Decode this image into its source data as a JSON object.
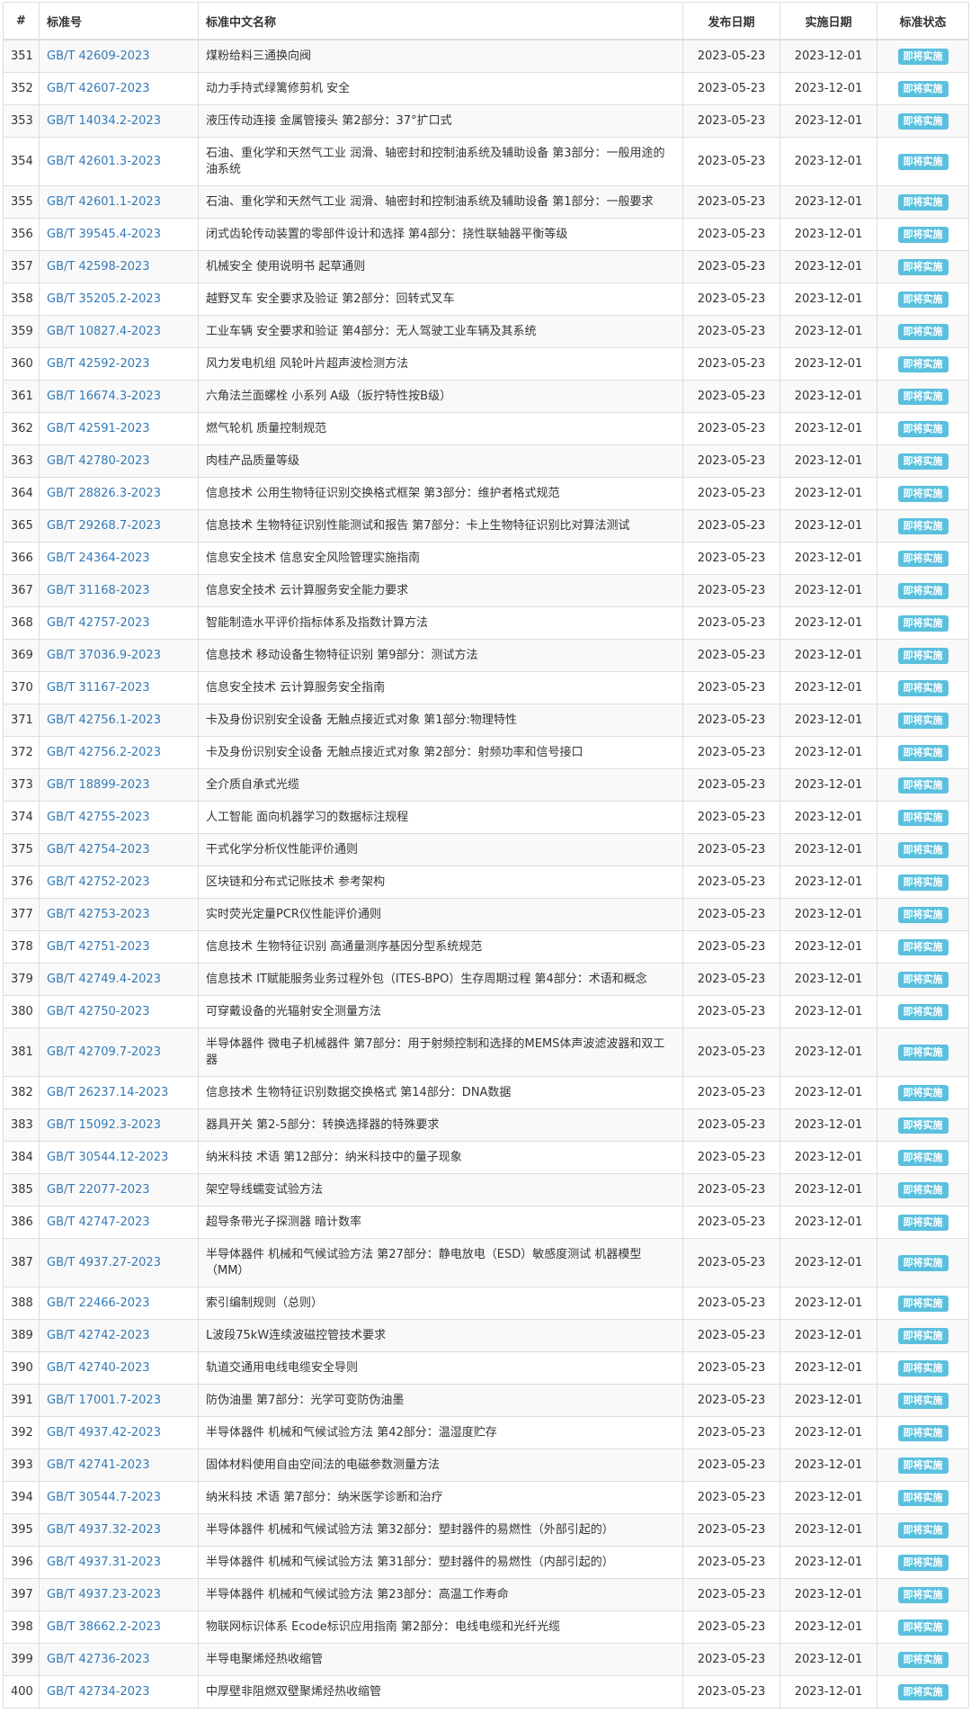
{
  "headers": {
    "num": "#",
    "code": "标准号",
    "name": "标准中文名称",
    "publish": "发布日期",
    "implement": "实施日期",
    "status": "标准状态"
  },
  "colors": {
    "link": "#337ab7",
    "badge": "#5bc0de",
    "border": "#dddddd",
    "stripe": "#f9f9f9"
  },
  "rows": [
    {
      "n": "351",
      "code": "GB/T 42609-2023",
      "name": "煤粉给料三通换向阀",
      "pub": "2023-05-23",
      "impl": "2023-12-01",
      "status": "即将实施"
    },
    {
      "n": "352",
      "code": "GB/T 42607-2023",
      "name": "动力手持式绿篱修剪机 安全",
      "pub": "2023-05-23",
      "impl": "2023-12-01",
      "status": "即将实施"
    },
    {
      "n": "353",
      "code": "GB/T 14034.2-2023",
      "name": "液压传动连接 金属管接头 第2部分：37°扩口式",
      "pub": "2023-05-23",
      "impl": "2023-12-01",
      "status": "即将实施"
    },
    {
      "n": "354",
      "code": "GB/T 42601.3-2023",
      "name": "石油、重化学和天然气工业 润滑、轴密封和控制油系统及辅助设备 第3部分：一般用途的油系统",
      "pub": "2023-05-23",
      "impl": "2023-12-01",
      "status": "即将实施",
      "tall": true
    },
    {
      "n": "355",
      "code": "GB/T 42601.1-2023",
      "name": "石油、重化学和天然气工业 润滑、轴密封和控制油系统及辅助设备 第1部分：一般要求",
      "pub": "2023-05-23",
      "impl": "2023-12-01",
      "status": "即将实施"
    },
    {
      "n": "356",
      "code": "GB/T 39545.4-2023",
      "name": "闭式齿轮传动装置的零部件设计和选择 第4部分：挠性联轴器平衡等级",
      "pub": "2023-05-23",
      "impl": "2023-12-01",
      "status": "即将实施"
    },
    {
      "n": "357",
      "code": "GB/T 42598-2023",
      "name": "机械安全 使用说明书 起草通则",
      "pub": "2023-05-23",
      "impl": "2023-12-01",
      "status": "即将实施"
    },
    {
      "n": "358",
      "code": "GB/T 35205.2-2023",
      "name": "越野叉车 安全要求及验证 第2部分：回转式叉车",
      "pub": "2023-05-23",
      "impl": "2023-12-01",
      "status": "即将实施"
    },
    {
      "n": "359",
      "code": "GB/T 10827.4-2023",
      "name": "工业车辆 安全要求和验证 第4部分：无人驾驶工业车辆及其系统",
      "pub": "2023-05-23",
      "impl": "2023-12-01",
      "status": "即将实施"
    },
    {
      "n": "360",
      "code": "GB/T 42592-2023",
      "name": "风力发电机组 风轮叶片超声波检测方法",
      "pub": "2023-05-23",
      "impl": "2023-12-01",
      "status": "即将实施"
    },
    {
      "n": "361",
      "code": "GB/T 16674.3-2023",
      "name": "六角法兰面螺栓 小系列 A级（扳拧特性按B级）",
      "pub": "2023-05-23",
      "impl": "2023-12-01",
      "status": "即将实施"
    },
    {
      "n": "362",
      "code": "GB/T 42591-2023",
      "name": "燃气轮机 质量控制规范",
      "pub": "2023-05-23",
      "impl": "2023-12-01",
      "status": "即将实施"
    },
    {
      "n": "363",
      "code": "GB/T 42780-2023",
      "name": "肉桂产品质量等级",
      "pub": "2023-05-23",
      "impl": "2023-12-01",
      "status": "即将实施"
    },
    {
      "n": "364",
      "code": "GB/T 28826.3-2023",
      "name": "信息技术 公用生物特征识别交换格式框架 第3部分：维护者格式规范",
      "pub": "2023-05-23",
      "impl": "2023-12-01",
      "status": "即将实施"
    },
    {
      "n": "365",
      "code": "GB/T 29268.7-2023",
      "name": "信息技术 生物特征识别性能测试和报告 第7部分：卡上生物特征识别比对算法测试",
      "pub": "2023-05-23",
      "impl": "2023-12-01",
      "status": "即将实施"
    },
    {
      "n": "366",
      "code": "GB/T 24364-2023",
      "name": "信息安全技术 信息安全风险管理实施指南",
      "pub": "2023-05-23",
      "impl": "2023-12-01",
      "status": "即将实施"
    },
    {
      "n": "367",
      "code": "GB/T 31168-2023",
      "name": "信息安全技术 云计算服务安全能力要求",
      "pub": "2023-05-23",
      "impl": "2023-12-01",
      "status": "即将实施"
    },
    {
      "n": "368",
      "code": "GB/T 42757-2023",
      "name": "智能制造水平评价指标体系及指数计算方法",
      "pub": "2023-05-23",
      "impl": "2023-12-01",
      "status": "即将实施"
    },
    {
      "n": "369",
      "code": "GB/T 37036.9-2023",
      "name": "信息技术 移动设备生物特征识别 第9部分：测试方法",
      "pub": "2023-05-23",
      "impl": "2023-12-01",
      "status": "即将实施"
    },
    {
      "n": "370",
      "code": "GB/T 31167-2023",
      "name": "信息安全技术 云计算服务安全指南",
      "pub": "2023-05-23",
      "impl": "2023-12-01",
      "status": "即将实施"
    },
    {
      "n": "371",
      "code": "GB/T 42756.1-2023",
      "name": "卡及身份识别安全设备 无触点接近式对象 第1部分:物理特性",
      "pub": "2023-05-23",
      "impl": "2023-12-01",
      "status": "即将实施"
    },
    {
      "n": "372",
      "code": "GB/T 42756.2-2023",
      "name": "卡及身份识别安全设备 无触点接近式对象 第2部分：射频功率和信号接口",
      "pub": "2023-05-23",
      "impl": "2023-12-01",
      "status": "即将实施"
    },
    {
      "n": "373",
      "code": "GB/T 18899-2023",
      "name": "全介质自承式光缆",
      "pub": "2023-05-23",
      "impl": "2023-12-01",
      "status": "即将实施"
    },
    {
      "n": "374",
      "code": "GB/T 42755-2023",
      "name": "人工智能 面向机器学习的数据标注规程",
      "pub": "2023-05-23",
      "impl": "2023-12-01",
      "status": "即将实施"
    },
    {
      "n": "375",
      "code": "GB/T 42754-2023",
      "name": "干式化学分析仪性能评价通则",
      "pub": "2023-05-23",
      "impl": "2023-12-01",
      "status": "即将实施"
    },
    {
      "n": "376",
      "code": "GB/T 42752-2023",
      "name": "区块链和分布式记账技术 参考架构",
      "pub": "2023-05-23",
      "impl": "2023-12-01",
      "status": "即将实施"
    },
    {
      "n": "377",
      "code": "GB/T 42753-2023",
      "name": "实时荧光定量PCR仪性能评价通则",
      "pub": "2023-05-23",
      "impl": "2023-12-01",
      "status": "即将实施"
    },
    {
      "n": "378",
      "code": "GB/T 42751-2023",
      "name": "信息技术 生物特征识别 高通量测序基因分型系统规范",
      "pub": "2023-05-23",
      "impl": "2023-12-01",
      "status": "即将实施"
    },
    {
      "n": "379",
      "code": "GB/T 42749.4-2023",
      "name": "信息技术 IT赋能服务业务过程外包（ITES-BPO）生存周期过程 第4部分：术语和概念",
      "pub": "2023-05-23",
      "impl": "2023-12-01",
      "status": "即将实施"
    },
    {
      "n": "380",
      "code": "GB/T 42750-2023",
      "name": "可穿戴设备的光辐射安全测量方法",
      "pub": "2023-05-23",
      "impl": "2023-12-01",
      "status": "即将实施"
    },
    {
      "n": "381",
      "code": "GB/T 42709.7-2023",
      "name": "半导体器件 微电子机械器件 第7部分：用于射频控制和选择的MEMS体声波滤波器和双工器",
      "pub": "2023-05-23",
      "impl": "2023-12-01",
      "status": "即将实施",
      "tall": true
    },
    {
      "n": "382",
      "code": "GB/T 26237.14-2023",
      "name": "信息技术 生物特征识别数据交换格式 第14部分：DNA数据",
      "pub": "2023-05-23",
      "impl": "2023-12-01",
      "status": "即将实施"
    },
    {
      "n": "383",
      "code": "GB/T 15092.3-2023",
      "name": "器具开关 第2-5部分：转换选择器的特殊要求",
      "pub": "2023-05-23",
      "impl": "2023-12-01",
      "status": "即将实施"
    },
    {
      "n": "384",
      "code": "GB/T 30544.12-2023",
      "name": "纳米科技 术语 第12部分：纳米科技中的量子现象",
      "pub": "2023-05-23",
      "impl": "2023-12-01",
      "status": "即将实施"
    },
    {
      "n": "385",
      "code": "GB/T 22077-2023",
      "name": "架空导线蠕变试验方法",
      "pub": "2023-05-23",
      "impl": "2023-12-01",
      "status": "即将实施"
    },
    {
      "n": "386",
      "code": "GB/T 42747-2023",
      "name": "超导条带光子探测器 暗计数率",
      "pub": "2023-05-23",
      "impl": "2023-12-01",
      "status": "即将实施"
    },
    {
      "n": "387",
      "code": "GB/T 4937.27-2023",
      "name": "半导体器件 机械和气候试验方法 第27部分：静电放电（ESD）敏感度测试 机器模型（MM）",
      "pub": "2023-05-23",
      "impl": "2023-12-01",
      "status": "即将实施",
      "tall": true
    },
    {
      "n": "388",
      "code": "GB/T 22466-2023",
      "name": "索引编制规则（总则）",
      "pub": "2023-05-23",
      "impl": "2023-12-01",
      "status": "即将实施"
    },
    {
      "n": "389",
      "code": "GB/T 42742-2023",
      "name": "L波段75kW连续波磁控管技术要求",
      "pub": "2023-05-23",
      "impl": "2023-12-01",
      "status": "即将实施"
    },
    {
      "n": "390",
      "code": "GB/T 42740-2023",
      "name": "轨道交通用电线电缆安全导则",
      "pub": "2023-05-23",
      "impl": "2023-12-01",
      "status": "即将实施"
    },
    {
      "n": "391",
      "code": "GB/T 17001.7-2023",
      "name": "防伪油墨 第7部分：光学可变防伪油墨",
      "pub": "2023-05-23",
      "impl": "2023-12-01",
      "status": "即将实施"
    },
    {
      "n": "392",
      "code": "GB/T 4937.42-2023",
      "name": "半导体器件 机械和气候试验方法 第42部分：温湿度贮存",
      "pub": "2023-05-23",
      "impl": "2023-12-01",
      "status": "即将实施"
    },
    {
      "n": "393",
      "code": "GB/T 42741-2023",
      "name": "固体材料使用自由空间法的电磁参数测量方法",
      "pub": "2023-05-23",
      "impl": "2023-12-01",
      "status": "即将实施"
    },
    {
      "n": "394",
      "code": "GB/T 30544.7-2023",
      "name": "纳米科技 术语 第7部分：纳米医学诊断和治疗",
      "pub": "2023-05-23",
      "impl": "2023-12-01",
      "status": "即将实施"
    },
    {
      "n": "395",
      "code": "GB/T 4937.32-2023",
      "name": "半导体器件 机械和气候试验方法 第32部分：塑封器件的易燃性（外部引起的）",
      "pub": "2023-05-23",
      "impl": "2023-12-01",
      "status": "即将实施"
    },
    {
      "n": "396",
      "code": "GB/T 4937.31-2023",
      "name": "半导体器件 机械和气候试验方法 第31部分：塑封器件的易燃性（内部引起的）",
      "pub": "2023-05-23",
      "impl": "2023-12-01",
      "status": "即将实施"
    },
    {
      "n": "397",
      "code": "GB/T 4937.23-2023",
      "name": "半导体器件 机械和气候试验方法 第23部分：高温工作寿命",
      "pub": "2023-05-23",
      "impl": "2023-12-01",
      "status": "即将实施"
    },
    {
      "n": "398",
      "code": "GB/T 38662.2-2023",
      "name": "物联网标识体系 Ecode标识应用指南 第2部分：电线电缆和光纤光缆",
      "pub": "2023-05-23",
      "impl": "2023-12-01",
      "status": "即将实施"
    },
    {
      "n": "399",
      "code": "GB/T 42736-2023",
      "name": "半导电聚烯烃热收缩管",
      "pub": "2023-05-23",
      "impl": "2023-12-01",
      "status": "即将实施"
    },
    {
      "n": "400",
      "code": "GB/T 42734-2023",
      "name": "中厚壁非阻燃双壁聚烯烃热收缩管",
      "pub": "2023-05-23",
      "impl": "2023-12-01",
      "status": "即将实施"
    }
  ]
}
